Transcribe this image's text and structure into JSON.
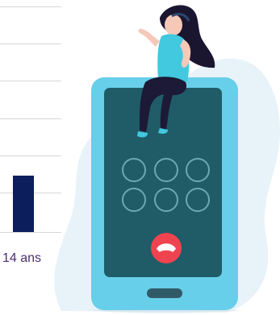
{
  "chart_data": {
    "type": "bar",
    "categories": [
      "14 ans"
    ],
    "values": [
      1
    ],
    "title": "",
    "xlabel": "",
    "ylabel": ""
  },
  "illustration": {
    "name": "woman-on-phone-call",
    "call_button_icon": "end-call-icon",
    "colors": {
      "blob": "#e8f3f9",
      "phone_body": "#67cfe9",
      "phone_screen": "#1f5c68",
      "call_button": "#ef4350",
      "character_top": "#42c8df",
      "character_hair": "#1b1630",
      "character_legs": "#1c1a36"
    }
  }
}
